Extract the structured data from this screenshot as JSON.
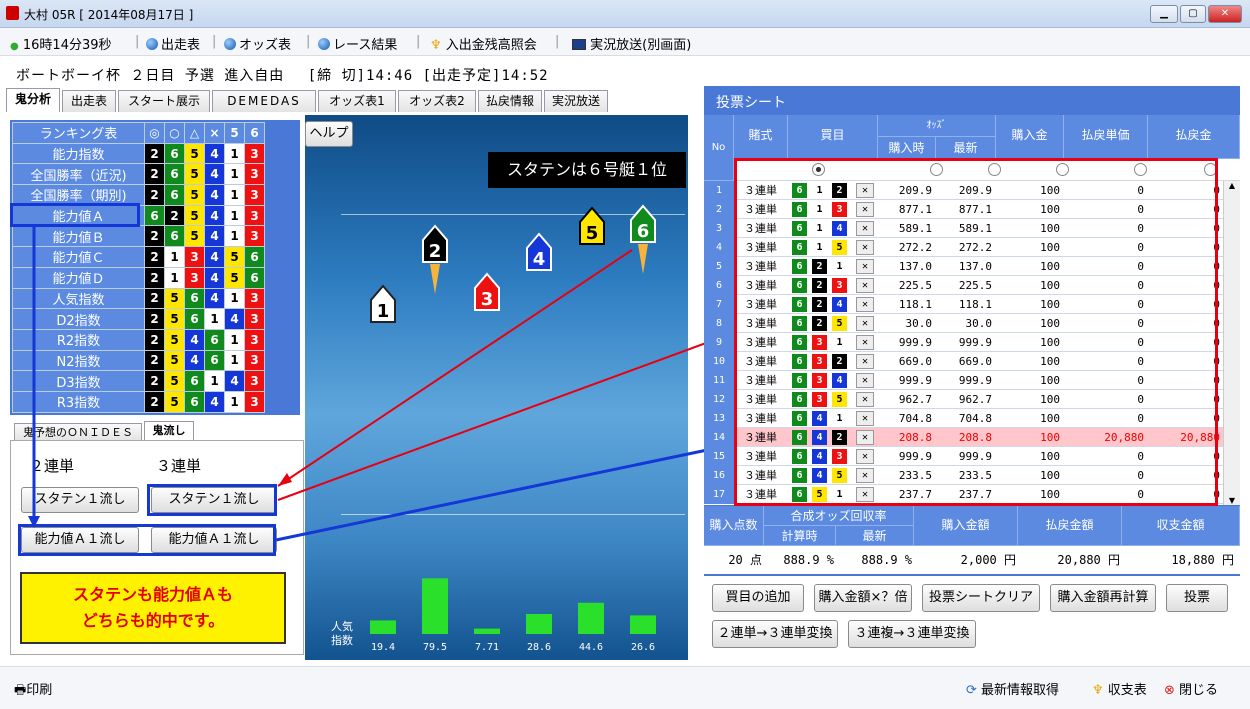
{
  "window": {
    "title": "大村 05R [ 2014年08月17日 ]"
  },
  "toolbar": {
    "time": "16時14分39秒",
    "items": [
      "出走表",
      "オッズ表",
      "レース結果",
      "入出金残高照会",
      "実況放送(別画面)"
    ]
  },
  "race": {
    "title": "ボートボーイ杯 ２日目 予選 進入自由",
    "deadline": "[締 切]14:46",
    "scheduled": "[出走予定]14:52"
  },
  "tabs": [
    "鬼分析",
    "出走表",
    "スタート展示",
    "DEMEDAS",
    "オッズ表1",
    "オッズ表2",
    "払戻情報",
    "実況放送"
  ],
  "ranking": {
    "header": "ランキング表",
    "marks": [
      "◎",
      "○",
      "△",
      "×",
      "5",
      "6"
    ],
    "rows": [
      {
        "label": "能力指数",
        "boats": [
          "2",
          "6",
          "5",
          "4",
          "1",
          "3"
        ]
      },
      {
        "label": "全国勝率（近況)",
        "boats": [
          "2",
          "6",
          "5",
          "4",
          "1",
          "3"
        ]
      },
      {
        "label": "全国勝率（期別)",
        "boats": [
          "2",
          "6",
          "5",
          "4",
          "1",
          "3"
        ]
      },
      {
        "label": "能力値Ａ",
        "boats": [
          "6",
          "2",
          "5",
          "4",
          "1",
          "3"
        ]
      },
      {
        "label": "能力値Ｂ",
        "boats": [
          "2",
          "6",
          "5",
          "4",
          "1",
          "3"
        ]
      },
      {
        "label": "能力値Ｃ",
        "boats": [
          "2",
          "1",
          "3",
          "4",
          "5",
          "6"
        ]
      },
      {
        "label": "能力値Ｄ",
        "boats": [
          "2",
          "1",
          "3",
          "4",
          "5",
          "6"
        ]
      },
      {
        "label": "人気指数",
        "boats": [
          "2",
          "5",
          "6",
          "4",
          "1",
          "3"
        ]
      },
      {
        "label": "D2指数",
        "boats": [
          "2",
          "5",
          "6",
          "1",
          "4",
          "3"
        ]
      },
      {
        "label": "R2指数",
        "boats": [
          "2",
          "5",
          "4",
          "6",
          "1",
          "3"
        ]
      },
      {
        "label": "N2指数",
        "boats": [
          "2",
          "5",
          "4",
          "6",
          "1",
          "3"
        ]
      },
      {
        "label": "D3指数",
        "boats": [
          "2",
          "5",
          "6",
          "1",
          "4",
          "3"
        ]
      },
      {
        "label": "R3指数",
        "boats": [
          "2",
          "5",
          "6",
          "4",
          "1",
          "3"
        ]
      }
    ]
  },
  "lower_tabs": [
    "鬼予想のＯＮＩＤＥＳ",
    "鬼流し"
  ],
  "oni": {
    "col1": "２連単",
    "col2": "３連単",
    "btn_staten2": "スタテン１流し",
    "btn_staten3": "スタテン１流し",
    "btn_a2": "能力値Ａ１流し",
    "btn_a3": "能力値Ａ１流し"
  },
  "note": {
    "line1": "スタテンも能力値Ａも",
    "line2": "どちらも的中です。"
  },
  "help_label": "ヘルプ",
  "staten_banner": "スタテンは６号艇１位",
  "boats_chart": {
    "axis_label_1": "人気",
    "axis_label_2": "指数",
    "values": [
      19.4,
      79.5,
      7.71,
      28.6,
      44.6,
      26.6
    ],
    "labels": [
      "19.4",
      "79.5",
      "7.71",
      "28.6",
      "44.6",
      "26.6"
    ]
  },
  "sheet": {
    "title": "投票シート",
    "headers": {
      "no": "No",
      "type": "賭式",
      "combo": "買目",
      "odds": "ｵｯｽﾞ",
      "odds_buy": "購入時",
      "odds_latest": "最新",
      "amount": "購入金",
      "payout_unit": "払戻単価",
      "payout": "払戻金"
    },
    "rows": [
      {
        "no": "1",
        "type": "３連単",
        "b": [
          "6",
          "1",
          "2"
        ],
        "o1": "209.9",
        "o2": "209.9",
        "amt": "100",
        "unit": "0",
        "pay": "0"
      },
      {
        "no": "2",
        "type": "３連単",
        "b": [
          "6",
          "1",
          "3"
        ],
        "o1": "877.1",
        "o2": "877.1",
        "amt": "100",
        "unit": "0",
        "pay": "0"
      },
      {
        "no": "3",
        "type": "３連単",
        "b": [
          "6",
          "1",
          "4"
        ],
        "o1": "589.1",
        "o2": "589.1",
        "amt": "100",
        "unit": "0",
        "pay": "0"
      },
      {
        "no": "4",
        "type": "３連単",
        "b": [
          "6",
          "1",
          "5"
        ],
        "o1": "272.2",
        "o2": "272.2",
        "amt": "100",
        "unit": "0",
        "pay": "0"
      },
      {
        "no": "5",
        "type": "３連単",
        "b": [
          "6",
          "2",
          "1"
        ],
        "o1": "137.0",
        "o2": "137.0",
        "amt": "100",
        "unit": "0",
        "pay": "0"
      },
      {
        "no": "6",
        "type": "３連単",
        "b": [
          "6",
          "2",
          "3"
        ],
        "o1": "225.5",
        "o2": "225.5",
        "amt": "100",
        "unit": "0",
        "pay": "0"
      },
      {
        "no": "7",
        "type": "３連単",
        "b": [
          "6",
          "2",
          "4"
        ],
        "o1": "118.1",
        "o2": "118.1",
        "amt": "100",
        "unit": "0",
        "pay": "0"
      },
      {
        "no": "8",
        "type": "３連単",
        "b": [
          "6",
          "2",
          "5"
        ],
        "o1": "30.0",
        "o2": "30.0",
        "amt": "100",
        "unit": "0",
        "pay": "0"
      },
      {
        "no": "9",
        "type": "３連単",
        "b": [
          "6",
          "3",
          "1"
        ],
        "o1": "999.9",
        "o2": "999.9",
        "amt": "100",
        "unit": "0",
        "pay": "0"
      },
      {
        "no": "10",
        "type": "３連単",
        "b": [
          "6",
          "3",
          "2"
        ],
        "o1": "669.0",
        "o2": "669.0",
        "amt": "100",
        "unit": "0",
        "pay": "0"
      },
      {
        "no": "11",
        "type": "３連単",
        "b": [
          "6",
          "3",
          "4"
        ],
        "o1": "999.9",
        "o2": "999.9",
        "amt": "100",
        "unit": "0",
        "pay": "0"
      },
      {
        "no": "12",
        "type": "３連単",
        "b": [
          "6",
          "3",
          "5"
        ],
        "o1": "962.7",
        "o2": "962.7",
        "amt": "100",
        "unit": "0",
        "pay": "0"
      },
      {
        "no": "13",
        "type": "３連単",
        "b": [
          "6",
          "4",
          "1"
        ],
        "o1": "704.8",
        "o2": "704.8",
        "amt": "100",
        "unit": "0",
        "pay": "0"
      },
      {
        "no": "14",
        "type": "３連単",
        "b": [
          "6",
          "4",
          "2"
        ],
        "o1": "208.8",
        "o2": "208.8",
        "amt": "100",
        "unit": "20,880",
        "pay": "20,880",
        "hit": true
      },
      {
        "no": "15",
        "type": "３連単",
        "b": [
          "6",
          "4",
          "3"
        ],
        "o1": "999.9",
        "o2": "999.9",
        "amt": "100",
        "unit": "0",
        "pay": "0"
      },
      {
        "no": "16",
        "type": "３連単",
        "b": [
          "6",
          "4",
          "5"
        ],
        "o1": "233.5",
        "o2": "233.5",
        "amt": "100",
        "unit": "0",
        "pay": "0"
      },
      {
        "no": "17",
        "type": "３連単",
        "b": [
          "6",
          "5",
          "1"
        ],
        "o1": "237.7",
        "o2": "237.7",
        "amt": "100",
        "unit": "0",
        "pay": "0"
      }
    ],
    "x_glyph": "✕"
  },
  "summary": {
    "points_label": "購入点数",
    "combined_label": "合成オッズ回収率",
    "buy_time": "計算時",
    "latest": "最新",
    "total_label": "購入金額",
    "payout_label": "払戻金額",
    "balance_label": "収支金額",
    "points": "20 点",
    "rate1": "888.9 %",
    "rate2": "888.9 %",
    "total": "2,000 円",
    "payout": "20,880 円",
    "balance": "18,880 円"
  },
  "actions": [
    "買目の追加",
    "購入金額×？倍",
    "投票シートクリア",
    "購入金額再計算",
    "投票",
    "２連単→３連単変換",
    "３連複→３連単変換"
  ],
  "status": {
    "print": "印刷",
    "refresh": "最新情報取得",
    "ledger": "収支表",
    "close": "閉じる"
  }
}
